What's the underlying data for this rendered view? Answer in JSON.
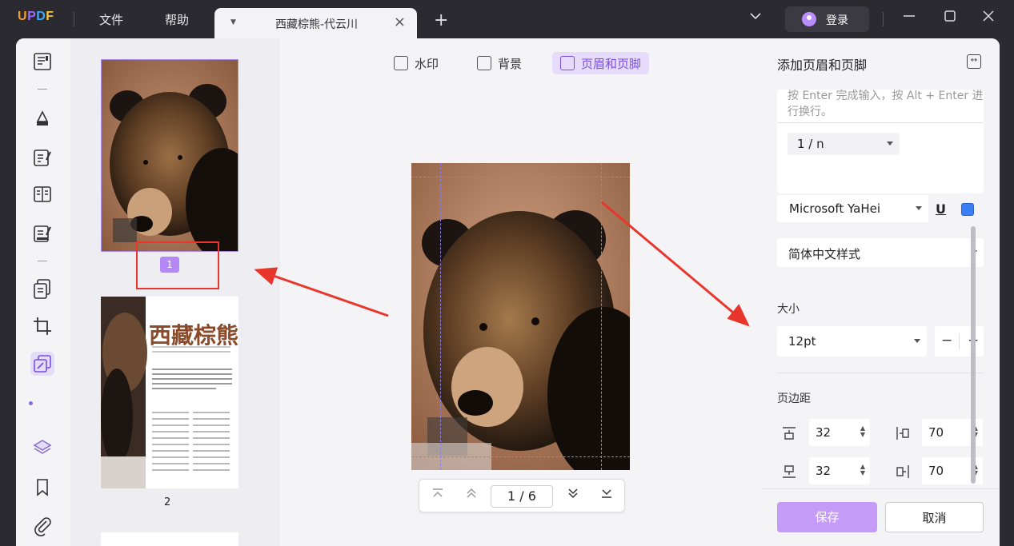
{
  "app": {
    "logo": "UPDF",
    "menu": [
      "文件",
      "帮助"
    ]
  },
  "tab": {
    "title": "西藏棕熊-代云川"
  },
  "window": {
    "login_label": "登录"
  },
  "doc_tabs": [
    {
      "label": "水印",
      "icon": "watermark-icon",
      "active": false
    },
    {
      "label": "背景",
      "icon": "background-icon",
      "active": false
    },
    {
      "label": "页眉和页脚",
      "icon": "header-footer-icon",
      "active": true
    }
  ],
  "thumbnails": [
    {
      "page": "1",
      "selected": true
    },
    {
      "page": "2",
      "title": "西藏棕熊",
      "selected": false
    }
  ],
  "navigation": {
    "page_display": "1 / 6"
  },
  "panel": {
    "title": "添加页眉和页脚",
    "hint": "按 Enter 完成输入，按 Alt + Enter 进行换行。",
    "page_format": "1 / n",
    "font": "Microsoft YaHei",
    "underline": "U",
    "color": "#3b7ef5",
    "style": "简体中文样式",
    "size_label": "大小",
    "size_value": "12pt",
    "minus": "−",
    "plus": "+",
    "margin_label": "页边距",
    "margin_top": "32",
    "margin_bottom": "32",
    "margin_left": "70",
    "margin_right": "70",
    "save": "保存",
    "cancel": "取消"
  },
  "colors": {
    "accent": "#b489f5",
    "annotation": "#e8362d"
  }
}
